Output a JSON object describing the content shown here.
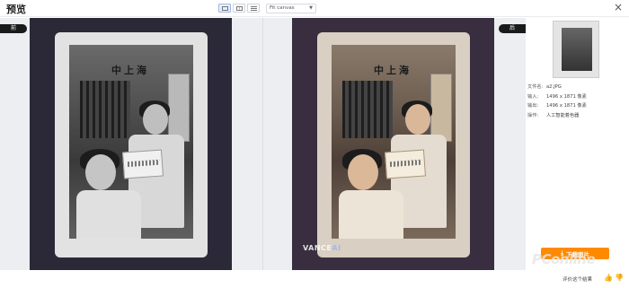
{
  "header": {
    "title": "预览",
    "view_modes": [
      "fullscreen",
      "side-by-side",
      "slider"
    ],
    "fit_select": "Fit canvas",
    "close_label": "×"
  },
  "panels": {
    "before_label": "前",
    "after_label": "后",
    "photo_sign_text": "中上海",
    "watermark_prefix": "VANCE",
    "watermark_suffix": "AI"
  },
  "info": {
    "filename_key": "文件名:",
    "filename_val": "a2.JPG",
    "input_key": "输入:",
    "input_val": "1496 x 1871 像素",
    "output_key": "输出:",
    "output_val": "1496 x 1871 像素",
    "operation_key": "操作:",
    "operation_val": "人工智能着色器"
  },
  "actions": {
    "download_label": "下载图片",
    "download_icon": "download-icon",
    "feedback_text": "评价这个结果",
    "like_icon": "thumbs-up-icon",
    "dislike_icon": "thumbs-down-icon"
  },
  "branding": {
    "watermark_text": "PConline"
  },
  "colors": {
    "accent_orange": "#ff8a00",
    "panel_bg": "#eceef1",
    "frame_before": "#2b2838",
    "frame_after": "#392e40"
  }
}
